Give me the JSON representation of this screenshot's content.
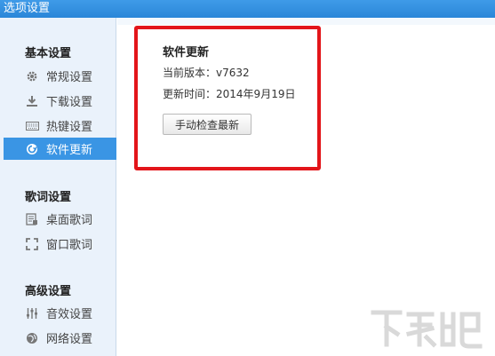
{
  "window": {
    "title": "选项设置"
  },
  "sidebar": {
    "groups": [
      {
        "title": "基本设置",
        "items": [
          {
            "label": "常规设置",
            "icon": "gear-icon"
          },
          {
            "label": "下载设置",
            "icon": "download-icon"
          },
          {
            "label": "热键设置",
            "icon": "keyboard-icon"
          },
          {
            "label": "软件更新",
            "icon": "update-icon",
            "active": true
          }
        ]
      },
      {
        "title": "歌词设置",
        "items": [
          {
            "label": "桌面歌词",
            "icon": "desktop-lyrics-icon"
          },
          {
            "label": "窗口歌词",
            "icon": "window-lyrics-icon"
          }
        ]
      },
      {
        "title": "高级设置",
        "items": [
          {
            "label": "音效设置",
            "icon": "equalizer-icon"
          },
          {
            "label": "网络设置",
            "icon": "network-icon"
          }
        ]
      }
    ]
  },
  "main": {
    "section_title": "软件更新",
    "current_version_label": "当前版本：",
    "current_version_value": "v7632",
    "update_time_label": "更新时间：",
    "update_time_value": "2014年9月19日",
    "check_button_label": "手动检查最新"
  },
  "colors": {
    "accent": "#3a95e4",
    "highlight_border": "#e3151a",
    "sidebar_bg": "#eaf2fb"
  }
}
